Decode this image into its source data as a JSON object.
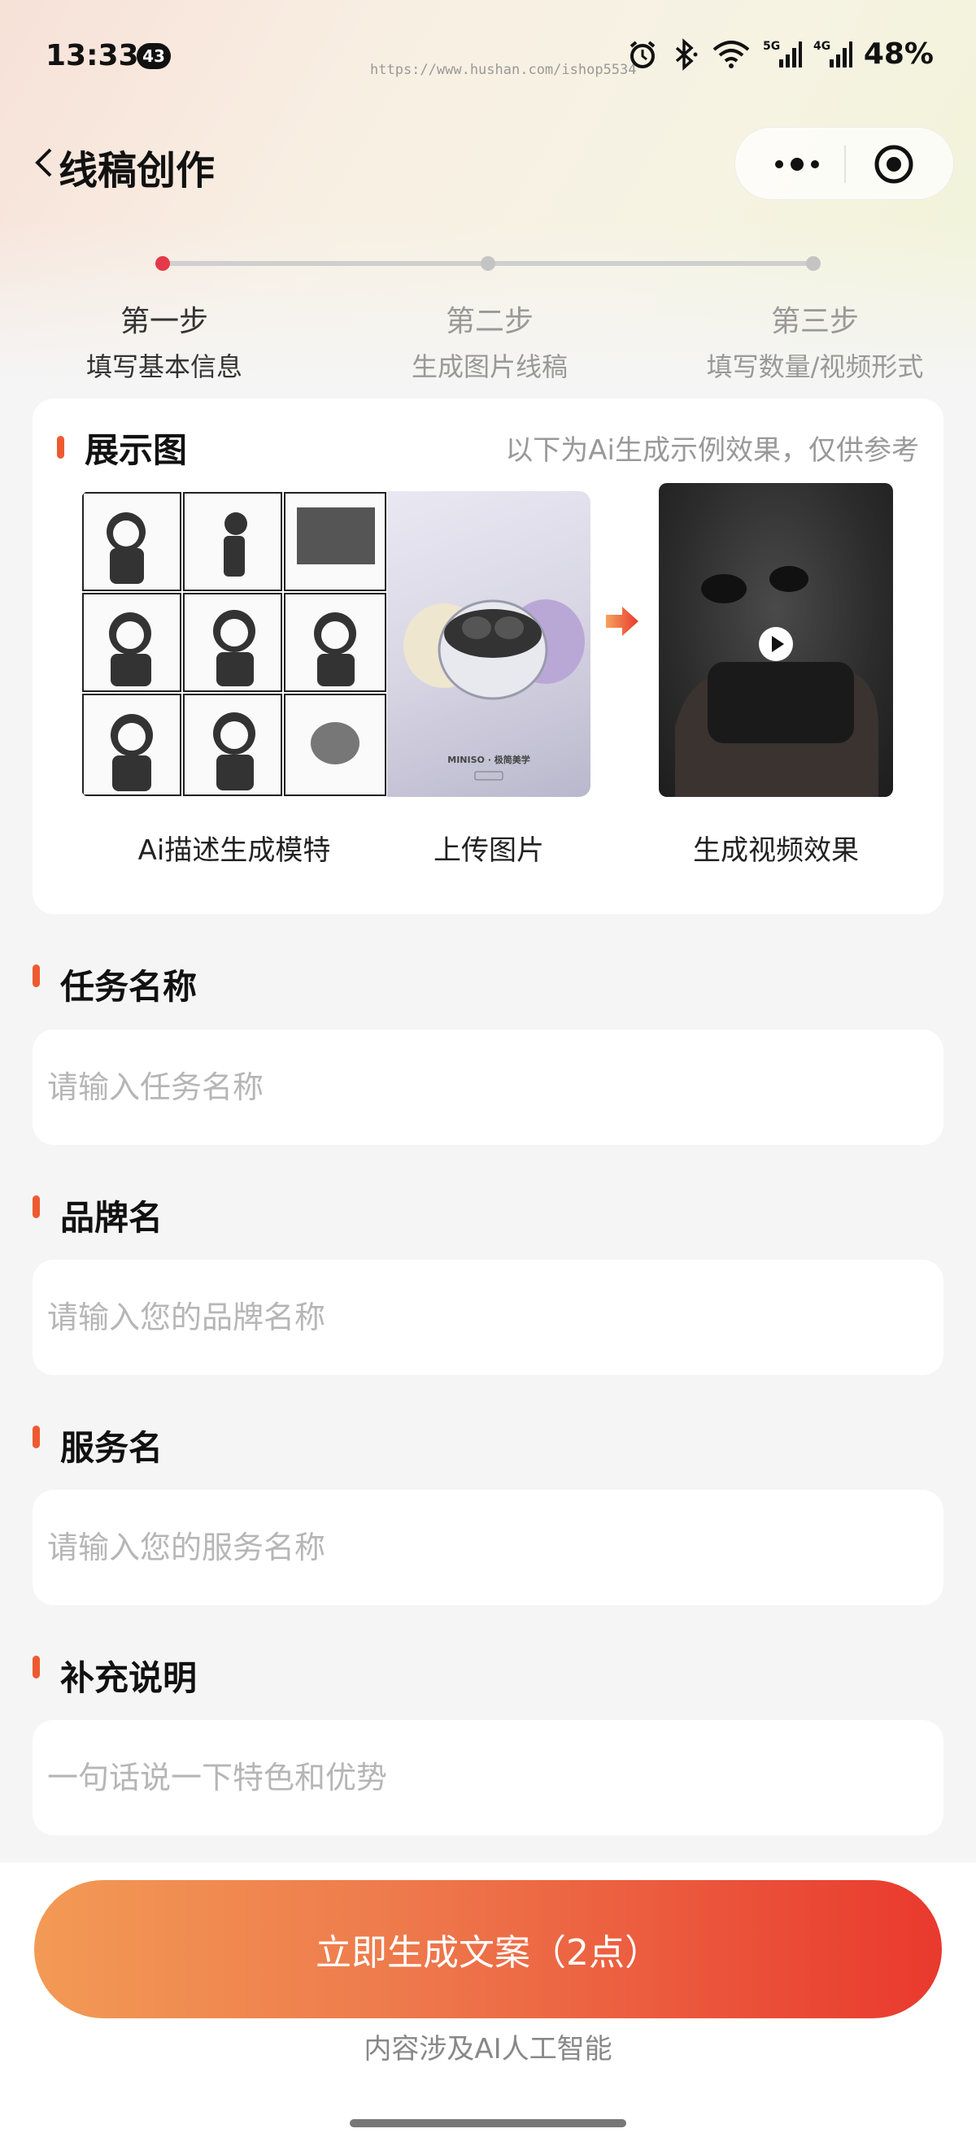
{
  "status_bar": {
    "time": "13:33",
    "notification_count": "43",
    "watermark": "https://www.hushan.com/ishop5534",
    "battery": "48%",
    "network_5g": "5G",
    "network_4g": "4G"
  },
  "nav": {
    "title": "线稿创作"
  },
  "steps": [
    {
      "title": "第一步",
      "subtitle": "填写基本信息",
      "active": true
    },
    {
      "title": "第二步",
      "subtitle": "生成图片线稿",
      "active": false
    },
    {
      "title": "第三步",
      "subtitle": "填写数量/视频形式",
      "active": false
    }
  ],
  "showcase": {
    "title": "展示图",
    "hint": "以下为Ai生成示例效果，仅供参考",
    "captions": [
      "Ai描述生成模特",
      "上传图片",
      "生成视频效果"
    ],
    "product_brand": "MINISO · 极简美学"
  },
  "form": {
    "task_name": {
      "label": "任务名称",
      "placeholder": "请输入任务名称"
    },
    "brand_name": {
      "label": "品牌名",
      "placeholder": "请输入您的品牌名称"
    },
    "service_name": {
      "label": "服务名",
      "placeholder": "请输入您的服务名称"
    },
    "description": {
      "label": "补充说明",
      "placeholder": "一句话说一下特色和优势"
    }
  },
  "bottom": {
    "submit_label": "立即生成文案（2点）",
    "ai_note": "内容涉及AI人工智能"
  },
  "colors": {
    "accent": "#ee5a2f",
    "active_step": "#e5394a",
    "button_start": "#f29a55",
    "button_end": "#e9392e"
  }
}
